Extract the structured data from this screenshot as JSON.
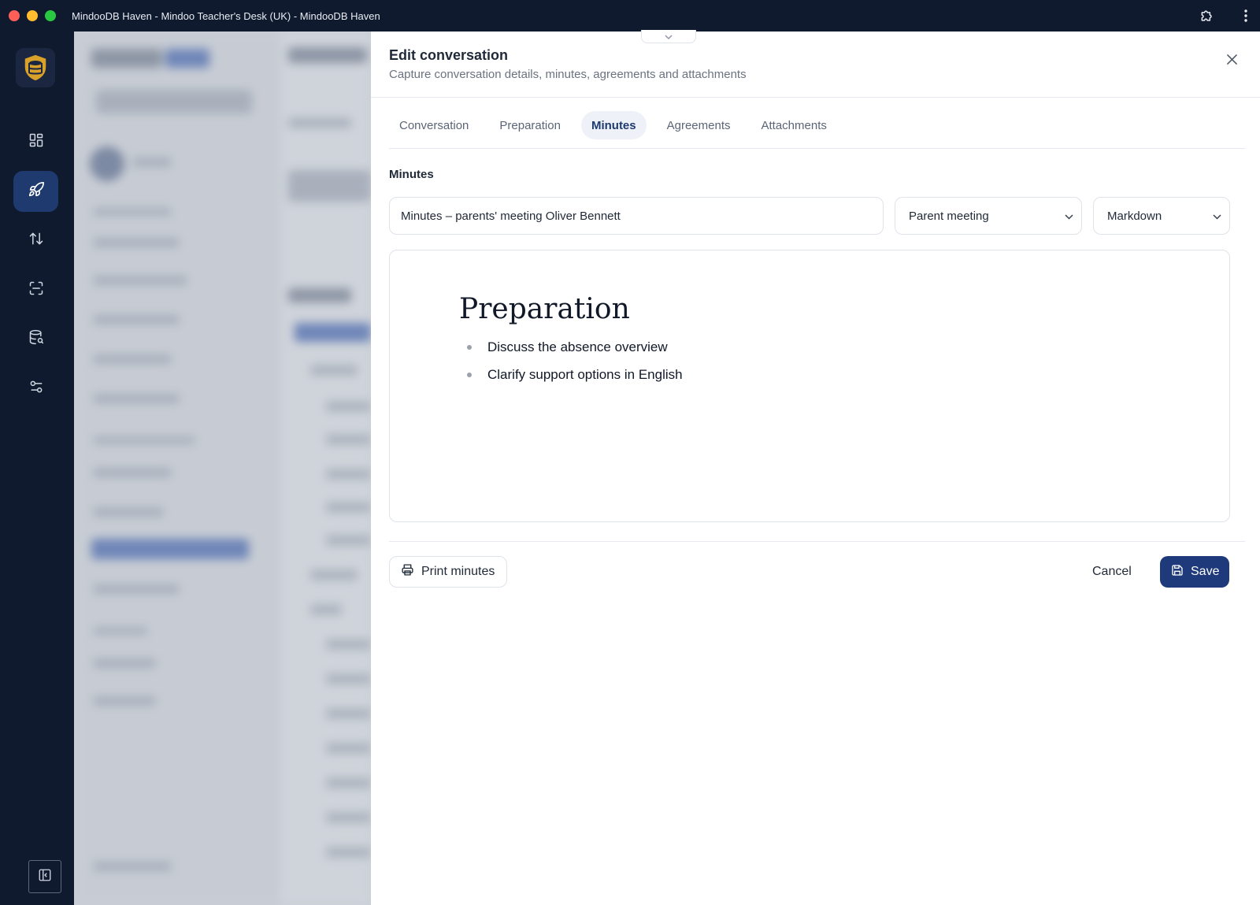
{
  "window": {
    "title": "MindooDB Haven - Mindoo Teacher's Desk (UK) - MindooDB Haven"
  },
  "rail": {
    "items": [
      {
        "icon": "dashboard-grid-icon",
        "active": false
      },
      {
        "icon": "rocket-icon",
        "active": true
      },
      {
        "icon": "sort-arrows-icon",
        "active": false
      },
      {
        "icon": "scan-icon",
        "active": false
      },
      {
        "icon": "database-search-icon",
        "active": false
      },
      {
        "icon": "sliders-icon",
        "active": false
      }
    ]
  },
  "panel": {
    "title": "Edit conversation",
    "subtitle": "Capture conversation details, minutes, agreements and attachments",
    "tabs": [
      {
        "label": "Conversation",
        "active": false
      },
      {
        "label": "Preparation",
        "active": false
      },
      {
        "label": "Minutes",
        "active": true
      },
      {
        "label": "Agreements",
        "active": false
      },
      {
        "label": "Attachments",
        "active": false
      }
    ],
    "section_label": "Minutes",
    "minutes_title_value": "Minutes – parents' meeting Oliver Bennett",
    "type_select": {
      "selected": "Parent meeting"
    },
    "format_select": {
      "selected": "Markdown"
    },
    "editor": {
      "heading": "Preparation",
      "items": [
        "Discuss the absence overview",
        "Clarify support options in English"
      ]
    },
    "footer": {
      "print_label": "Print minutes",
      "cancel_label": "Cancel",
      "save_label": "Save"
    }
  },
  "colors": {
    "chrome": "#0f1a2e",
    "rail_active": "#1e3a6e",
    "primary": "#1e3a7b",
    "tab_active_bg": "#eef1f7"
  }
}
